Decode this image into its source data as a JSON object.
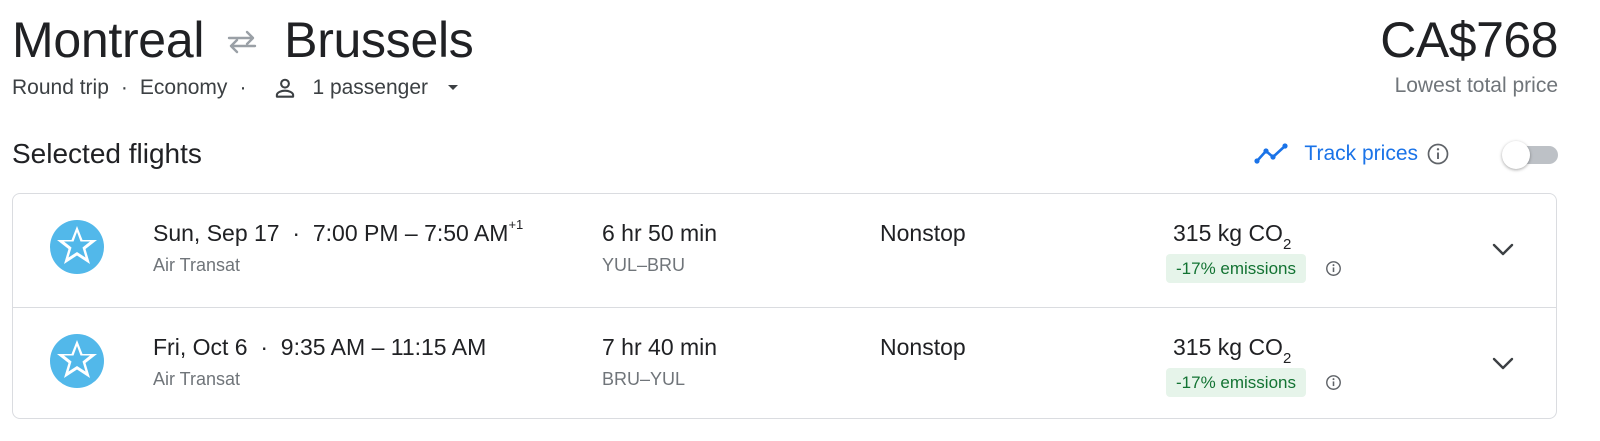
{
  "route": {
    "origin": "Montreal",
    "destination": "Brussels",
    "swap_icon": "round-trip-arrows-icon"
  },
  "trip": {
    "type": "Round trip",
    "separator": "·",
    "cabin": "Economy",
    "passengers": "1 passenger"
  },
  "price": {
    "amount": "CA$768",
    "caption": "Lowest total price"
  },
  "section_title": "Selected flights",
  "track": {
    "label": "Track prices",
    "enabled": false,
    "accent": "#1a73e8"
  },
  "flights": [
    {
      "date": "Sun, Sep 17",
      "sep": "·",
      "times": "7:00 PM – 7:50 AM",
      "day_offset": "+1",
      "airline": "Air Transat",
      "duration": "6 hr 50 min",
      "codes": "YUL–BRU",
      "stops": "Nonstop",
      "co2_prefix": "315 kg CO",
      "co2_sub": "2",
      "emissions": "-17% emissions"
    },
    {
      "date": "Fri, Oct 6",
      "sep": "·",
      "times": "9:35 AM – 11:15 AM",
      "day_offset": "",
      "airline": "Air Transat",
      "duration": "7 hr 40 min",
      "codes": "BRU–YUL",
      "stops": "Nonstop",
      "co2_prefix": "315 kg CO",
      "co2_sub": "2",
      "emissions": "-17% emissions"
    }
  ],
  "colors": {
    "emissions_bg": "#e6f4ea",
    "emissions_text": "#137333",
    "logo": "#52b8ea"
  }
}
